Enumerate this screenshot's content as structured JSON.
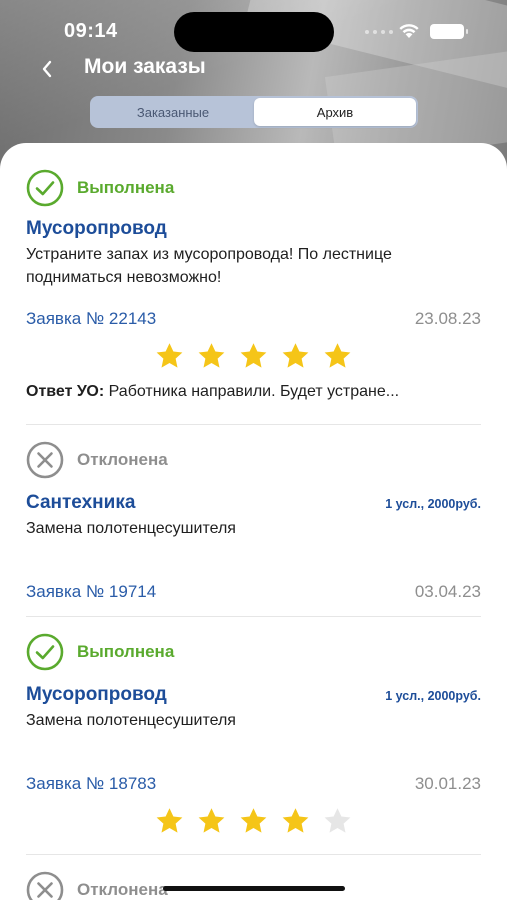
{
  "status_bar": {
    "time": "09:14"
  },
  "nav": {
    "title": "Мои заказы"
  },
  "segment": {
    "tabs": [
      "Заказанные",
      "Архив"
    ],
    "active": "Архив"
  },
  "orders": [
    {
      "status": "Выполнена",
      "status_type": "done",
      "title": "Мусоропровод",
      "price": "",
      "description": "Устраните запах из мусоропровода! По лестнице подниматься невозможно!",
      "number": "Заявка № 22143",
      "date": "23.08.23",
      "rating": 5,
      "answer_label": "Ответ УО:",
      "answer_text": "Работника направили. Будет устране..."
    },
    {
      "status": "Отклонена",
      "status_type": "rejected",
      "title": "Сантехника",
      "price": "1 усл., 2000руб.",
      "description": "Замена полотенцесушителя",
      "number": "Заявка № 19714",
      "date": "03.04.23"
    },
    {
      "status": "Выполнена",
      "status_type": "done",
      "title": "Мусоропровод",
      "price": "1 усл., 2000руб.",
      "description": "Замена полотенцесушителя",
      "number": "Заявка № 18783",
      "date": "30.01.23",
      "rating": 4
    },
    {
      "status": "Отклонена",
      "status_type": "rejected"
    }
  ],
  "colors": {
    "done": "#5aaa2e",
    "rejected": "#8e8e8e",
    "title": "#1d4d99",
    "star_on": "#f5c518",
    "star_off": "#e6e6e6"
  },
  "icons": {
    "done": "check-circle-icon",
    "rejected": "x-circle-icon",
    "back": "chevron-left-icon",
    "star": "star-icon"
  }
}
